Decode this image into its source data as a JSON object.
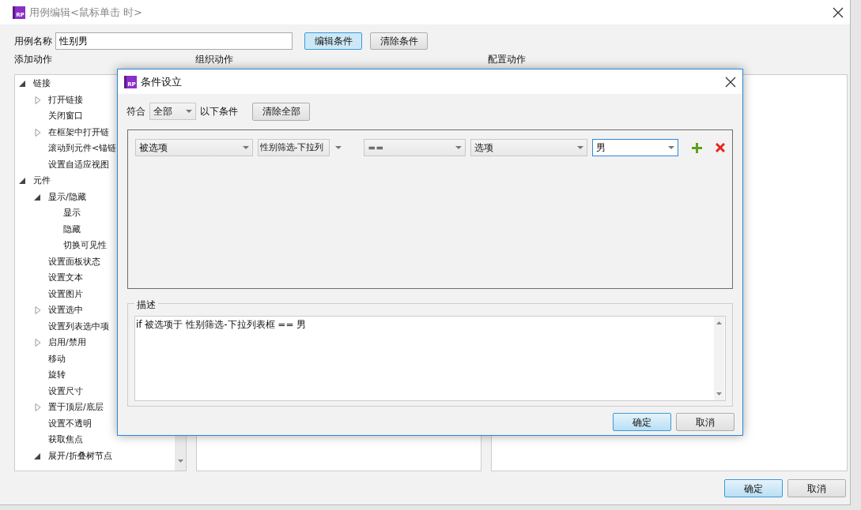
{
  "window": {
    "logo": "RP",
    "title": "用例编辑<鼠标单击 时>"
  },
  "case_name": {
    "label": "用例名称",
    "value": "性别男"
  },
  "top_buttons": [
    {
      "label": "编辑条件",
      "selected": true
    },
    {
      "label": "清除条件",
      "selected": false
    }
  ],
  "panels": [
    {
      "heading": "添加动作"
    },
    {
      "heading": "组织动作"
    },
    {
      "heading": "配置动作"
    }
  ],
  "action_tree": [
    {
      "label": "链接",
      "kind": "branch",
      "expanded": true,
      "children": [
        {
          "label": "打开链接",
          "kind": "branch",
          "expanded": false
        },
        {
          "label": "关闭窗口",
          "kind": "leaf"
        },
        {
          "label": "在框架中打开链",
          "kind": "branch",
          "expanded": false
        },
        {
          "label": "滚动到元件<锚链",
          "kind": "leaf"
        },
        {
          "label": "设置自适应视图",
          "kind": "leaf"
        }
      ]
    },
    {
      "label": "元件",
      "kind": "branch",
      "expanded": true,
      "children": [
        {
          "label": "显示/隐藏",
          "kind": "branch",
          "expanded": true,
          "children": [
            {
              "label": "显示",
              "kind": "leaf"
            },
            {
              "label": "隐藏",
              "kind": "leaf"
            },
            {
              "label": "切换可见性",
              "kind": "leaf"
            }
          ]
        },
        {
          "label": "设置面板状态",
          "kind": "leaf"
        },
        {
          "label": "设置文本",
          "kind": "leaf"
        },
        {
          "label": "设置图片",
          "kind": "leaf"
        },
        {
          "label": "设置选中",
          "kind": "branch",
          "expanded": false
        },
        {
          "label": "设置列表选中项",
          "kind": "leaf"
        },
        {
          "label": "启用/禁用",
          "kind": "branch",
          "expanded": false
        },
        {
          "label": "移动",
          "kind": "leaf"
        },
        {
          "label": "旋转",
          "kind": "leaf"
        },
        {
          "label": "设置尺寸",
          "kind": "leaf"
        },
        {
          "label": "置于顶层/底层",
          "kind": "branch",
          "expanded": false
        },
        {
          "label": "设置不透明",
          "kind": "leaf"
        },
        {
          "label": "获取焦点",
          "kind": "leaf"
        },
        {
          "label": "展开/折叠树节点",
          "kind": "branch",
          "expanded": true
        }
      ]
    }
  ],
  "footer_buttons": [
    {
      "label": "确定",
      "primary": true
    },
    {
      "label": "取消",
      "primary": false
    }
  ],
  "condition_dialog": {
    "logo": "RP",
    "title": "条件设立",
    "match_label": "符合",
    "match_value": "全部",
    "match_suffix": "以下条件",
    "clear_all": "清除全部",
    "conditions": [
      {
        "fields": [
          {
            "value": "被选项",
            "kind": "select",
            "focused": false
          },
          {
            "value": "性别筛选-下拉列",
            "kind": "split",
            "focused": false
          },
          {
            "value": "==",
            "kind": "select",
            "focused": false
          },
          {
            "value": "选项",
            "kind": "select",
            "focused": false
          },
          {
            "value": "男",
            "kind": "select",
            "focused": true
          }
        ]
      }
    ],
    "description": {
      "legend": "描述",
      "text": "if 被选项于 性别筛选-下拉列表框 == 男"
    },
    "buttons": [
      {
        "label": "确定",
        "primary": true
      },
      {
        "label": "取消",
        "primary": false
      }
    ]
  }
}
